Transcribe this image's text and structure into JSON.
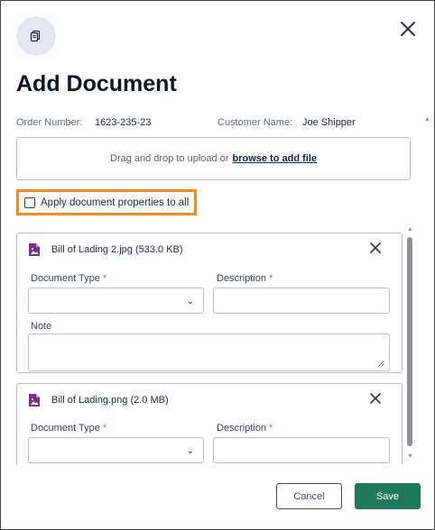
{
  "dialog": {
    "title": "Add Document"
  },
  "order": {
    "number_label": "Order Number:",
    "number_value": "1623-235-23",
    "customer_label": "Customer Name:",
    "customer_value": "Joe Shipper"
  },
  "upload": {
    "prompt": "Drag and drop to upload or",
    "link": "browse to add file"
  },
  "apply_all": {
    "label": "Apply document properties to all",
    "checked": false
  },
  "documents": [
    {
      "file_name": "Bill of Lading 2.jpg (533.0 KB)",
      "type_label": "Document Type",
      "type_value": "",
      "description_label": "Description",
      "description_value": "",
      "note_label": "Note",
      "note_value": ""
    },
    {
      "file_name": "Bill of Lading.png (2.0 MB)",
      "type_label": "Document Type",
      "type_value": "",
      "description_label": "Description",
      "description_value": ""
    }
  ],
  "required_marker": "*",
  "footer": {
    "cancel_label": "Cancel",
    "save_label": "Save"
  },
  "colors": {
    "accent_highlight": "#f28b22",
    "save_button": "#1f7a5c",
    "file_icon": "#7b2d8e",
    "required": "#e0563a"
  },
  "icons": {
    "header": "document-icon",
    "close": "close-icon",
    "file": "image-file-icon",
    "dropdown": "chevron-down-icon"
  }
}
